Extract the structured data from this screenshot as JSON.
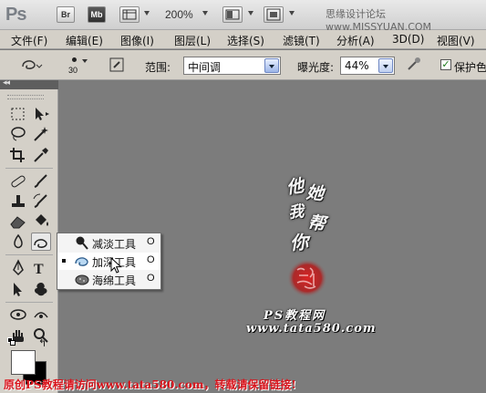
{
  "appbar": {
    "logo": "Ps",
    "bridge_label": "Br",
    "minibridge_label": "Mb",
    "zoom": "200%",
    "watermark_site": "思缘设计论坛  www.MISSYUAN.COM"
  },
  "menu": {
    "items": [
      "文件(F)",
      "编辑(E)",
      "图像(I)",
      "图层(L)",
      "选择(S)",
      "滤镜(T)",
      "分析(A)",
      "3D(D)",
      "视图(V)"
    ]
  },
  "options": {
    "brush_size": "30",
    "range_label": "范围:",
    "range_value": "中间调",
    "exposure_label": "曝光度:",
    "exposure_value": "44%",
    "protect_label": "保护色",
    "protect_checked": "✓"
  },
  "flyout": {
    "items": [
      {
        "label": "减淡工具",
        "shortcut": "O",
        "icon": "dodge-icon"
      },
      {
        "label": "加深工具",
        "shortcut": "O",
        "icon": "burn-icon"
      },
      {
        "label": "海绵工具",
        "shortcut": "O",
        "icon": "sponge-icon"
      }
    ]
  },
  "artwork": {
    "calligraphy": [
      "他",
      "她",
      "我",
      "帮",
      "你"
    ],
    "ps_label": "PS教程网",
    "url": "www.tata580.com",
    "seal_color": "#d42020"
  },
  "footer": {
    "banner": "原创PS教程请访问www.tata580.com，转载请保留链接!"
  },
  "colors": {
    "foreground": "#ffffff",
    "background": "#000000"
  }
}
